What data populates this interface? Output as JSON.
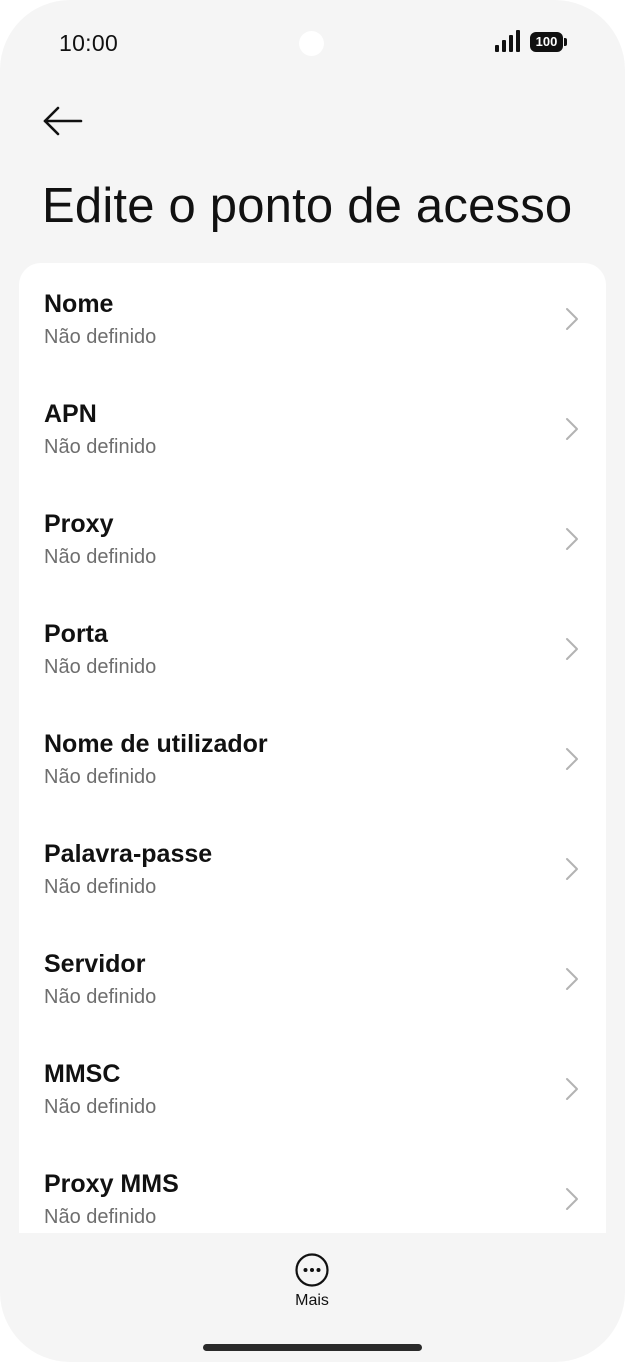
{
  "status_bar": {
    "time": "10:00",
    "battery": "100",
    "signal_icon": "signal-bars-icon"
  },
  "header": {
    "back_icon": "arrow-left-icon",
    "title": "Edite o ponto de acesso"
  },
  "settings": {
    "items": [
      {
        "label": "Nome",
        "value": "Não definido"
      },
      {
        "label": "APN",
        "value": "Não definido"
      },
      {
        "label": "Proxy",
        "value": "Não definido"
      },
      {
        "label": "Porta",
        "value": "Não definido"
      },
      {
        "label": "Nome de utilizador",
        "value": "Não definido"
      },
      {
        "label": "Palavra-passe",
        "value": "Não definido"
      },
      {
        "label": "Servidor",
        "value": "Não definido"
      },
      {
        "label": "MMSC",
        "value": "Não definido"
      },
      {
        "label": "Proxy MMS",
        "value": "Não definido"
      }
    ]
  },
  "bottom_bar": {
    "more_label": "Mais",
    "more_icon": "more-dots-icon"
  },
  "colors": {
    "background": "#f5f5f5",
    "card": "#ffffff",
    "text_primary": "#111111",
    "text_secondary": "#6e6e6e"
  }
}
